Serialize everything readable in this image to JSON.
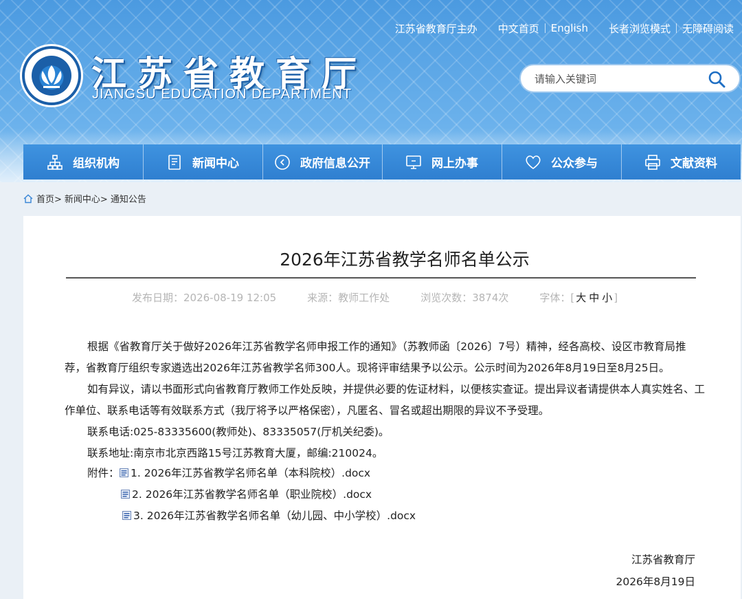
{
  "top_links": [
    "江苏省教育厅主办",
    "中文首页",
    "English",
    "长者浏览模式",
    "无障碍阅读"
  ],
  "brand": {
    "title": "江苏省教育厅",
    "subtitle": "JIANGSU EDUCATION DEPARTMENT"
  },
  "search": {
    "placeholder": "请输入关键词",
    "icon": "search-icon"
  },
  "nav": [
    {
      "label": "组织机构",
      "icon": "org-chart-icon"
    },
    {
      "label": "新闻中心",
      "icon": "document-icon"
    },
    {
      "label": "政府信息公开",
      "icon": "info-circle-icon"
    },
    {
      "label": "网上办事",
      "icon": "monitor-icon"
    },
    {
      "label": "公众参与",
      "icon": "heart-icon"
    },
    {
      "label": "文献资料",
      "icon": "printer-icon"
    }
  ],
  "breadcrumb": [
    "首页>",
    "新闻中心>",
    "通知公告"
  ],
  "article": {
    "title": "2026年江苏省教学名师名单公示",
    "meta": {
      "date": "发布日期：2026-08-19 12:05",
      "source": "来源：教师工作处",
      "views": "浏览次数：3874次",
      "font_label": "字体：[",
      "font_large": "大",
      "font_medium": "中",
      "font_small": "小",
      "font_close": "]"
    },
    "paragraphs": [
      "根据《省教育厅关于做好2026年江苏省教学名师申报工作的通知》（苏教师函〔2026〕7号）精神，经各高校、设区市教育局推荐，省教育厅组织专家遴选出2026年江苏省教学名师300人。现将评审结果予以公示。公示时间为2026年8月19日至8月25日。",
      "如有异议，请以书面形式向省教育厅教师工作处反映，并提供必要的佐证材料，以便核实查证。提出异议者请提供本人真实姓名、工作单位、联系电话等有效联系方式（我厅将予以严格保密），凡匿名、冒名或超出期限的异议不予受理。"
    ],
    "contact_phone": "联系电话:025-83335600(教师处)、83335057(厅机关纪委)。",
    "contact_address": "联系地址:南京市北京西路15号江苏教育大厦，邮编:210024。",
    "attachments_label": "附件：",
    "attachments": [
      "1. 2026年江苏省教学名师名单（本科院校）.docx",
      "2. 2026年江苏省教学名师名单（职业院校）.docx",
      "3. 2026年江苏省教学名师名单（幼儿园、中小学校）.docx"
    ],
    "signature": "江苏省教育厅",
    "sign_date": "2026年8月19日"
  },
  "colors": {
    "header_blue": "#4b9ae0",
    "nav_blue": "#2f7fd0",
    "page_bg": "#eaf0f6"
  }
}
